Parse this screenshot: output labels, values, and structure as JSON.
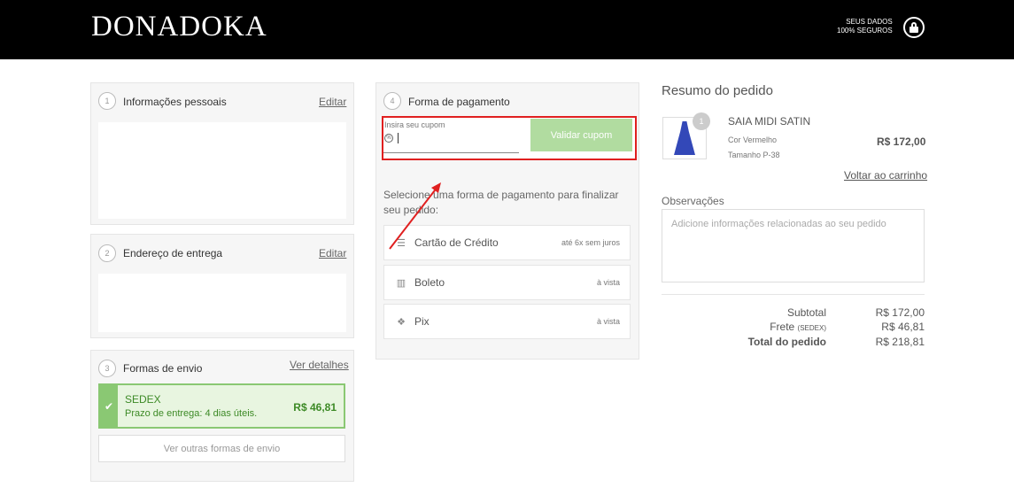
{
  "header": {
    "brand": "DONADOKA",
    "secure_line1": "SEUS DADOS",
    "secure_line2": "100% SEGUROS",
    "lock_icon": "lock-icon"
  },
  "personal": {
    "step": "1",
    "title": "Informações pessoais",
    "edit": "Editar"
  },
  "address": {
    "step": "2",
    "title": "Endereço de entrega",
    "edit": "Editar"
  },
  "shipping": {
    "step": "3",
    "title": "Formas de envio",
    "details_link": "Ver detalhes",
    "selected": {
      "name": "SEDEX",
      "eta": "Prazo de entrega: 4 dias úteis.",
      "price": "R$ 46,81"
    },
    "other_button": "Ver outras formas de envio"
  },
  "payment": {
    "step": "4",
    "title": "Forma de pagamento",
    "coupon_label": "Insira seu cupom",
    "coupon_button": "Validar cupom",
    "hint": "Selecione uma forma de pagamento para finalizar seu pedido:",
    "options": [
      {
        "name": "Cartão de Crédito",
        "terms": "até 6x sem juros",
        "icon": "credit-card-icon"
      },
      {
        "name": "Boleto",
        "terms": "à vista",
        "icon": "barcode-icon"
      },
      {
        "name": "Pix",
        "terms": "à vista",
        "icon": "pix-icon"
      }
    ]
  },
  "summary": {
    "title": "Resumo do pedido",
    "product": {
      "name": "SAIA MIDI SATIN",
      "color": "Cor Vermelho",
      "size": "Tamanho P-38",
      "price": "R$ 172,00",
      "qty": "1"
    },
    "back_to_cart": "Voltar ao carrinho",
    "notes_label": "Observações",
    "notes_placeholder": "Adicione informações relacionadas ao seu pedido",
    "subtotal_label": "Subtotal",
    "subtotal": "R$ 172,00",
    "freight_label": "Frete",
    "freight_method": "(SEDEX)",
    "freight": "R$ 46,81",
    "total_label": "Total do pedido",
    "total": "R$ 218,81"
  },
  "colors": {
    "header_bg": "#000000",
    "accent_green": "#8ac873",
    "highlight_red": "#e02020"
  }
}
